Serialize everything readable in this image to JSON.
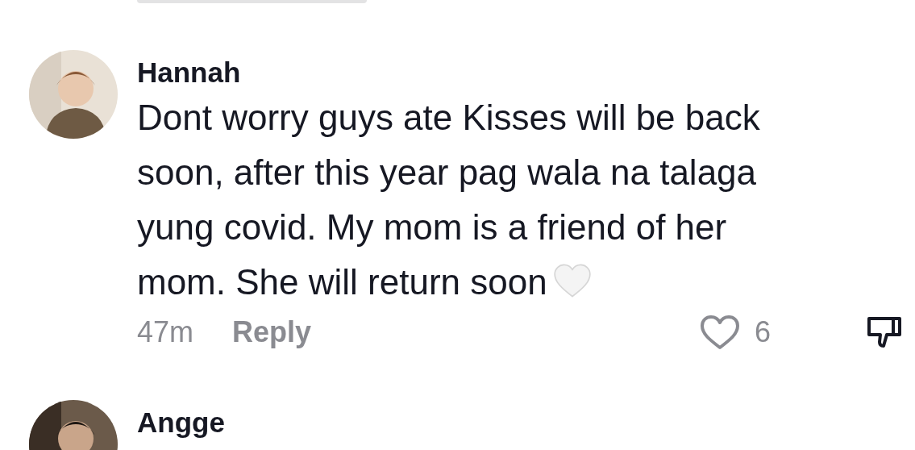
{
  "comments": [
    {
      "author": "Hannah",
      "text": "Dont worry guys ate Kisses will be back soon, after this year pag wala na talaga yung covid. My mom is a friend of her mom. She will return soon",
      "heart_emoji": true,
      "time": "47m",
      "reply": "Reply",
      "likes": "6",
      "liked": false
    },
    {
      "author": "Angge"
    }
  ]
}
